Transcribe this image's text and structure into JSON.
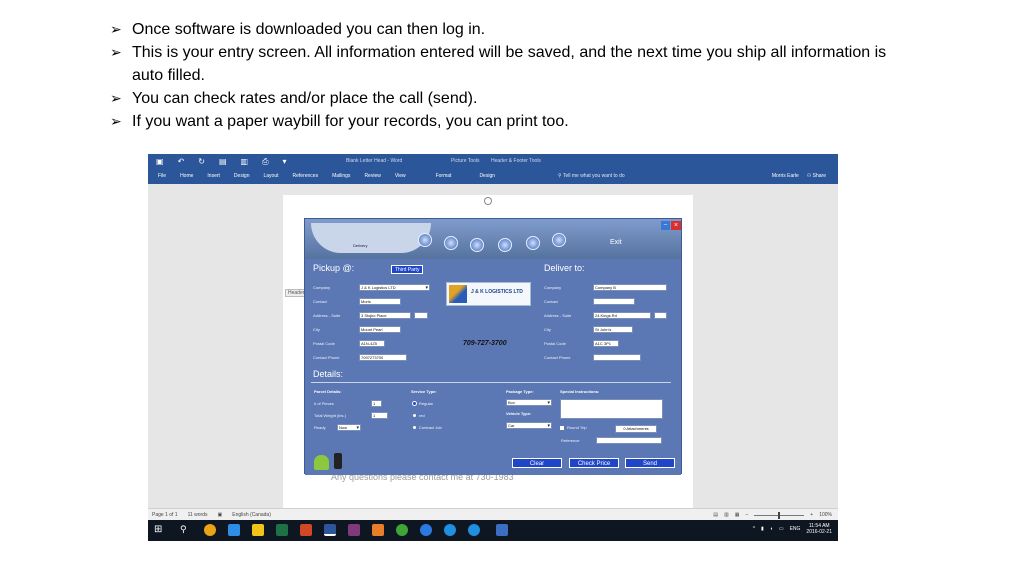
{
  "bullets": [
    "Once software is downloaded you can then log in.",
    "This is your entry screen. All information entered will be saved, and the next time you ship all information is auto filled.",
    "You can check rates and/or place the call (send).",
    "If you want a paper waybill for your records, you can print too."
  ],
  "bullet_marker": "➢",
  "word": {
    "title": "Blank Letter Head - Word",
    "contextual": [
      "Picture Tools",
      "Header & Footer Tools"
    ],
    "tabs": [
      "File",
      "Home",
      "Insert",
      "Design",
      "Layout",
      "References",
      "Mailings",
      "Review",
      "View",
      "Format",
      "Design"
    ],
    "tell_me": "Tell me what you want to do",
    "user": "Morris Earle",
    "share": "Share",
    "header_tag": "Header",
    "doc_text": "Any questions please contact me at 730-1983",
    "status": {
      "page": "Page 1 of 1",
      "words": "11 words",
      "language": "English (Canada)",
      "zoom": "100%"
    }
  },
  "app": {
    "delivery_tab": "Delivery",
    "exit_label": "Exit",
    "minimize_label": "–",
    "close_label": "×",
    "pickup_title": "Pickup @:",
    "third_party": "Third Party",
    "deliver_title": "Deliver to:",
    "logo_text": "J & K LOGISTICS LTD",
    "phone": "709-727-3700",
    "pickup": {
      "company_label": "Company",
      "company": "J & K Logistics LTD",
      "contact_label": "Contact",
      "contact": "Moris",
      "address_label": "Address - Suite",
      "address": "3 Stojko Place",
      "city_label": "City",
      "city": "Mount Pearl",
      "postal_label": "Postal Code",
      "postal": "A1N-4Z5",
      "phone_label": "Contact Phone",
      "phone": "7097273700"
    },
    "deliver": {
      "company_label": "Company",
      "company": "Company B",
      "contact_label": "Contact",
      "contact": "",
      "address_label": "Address - Suite",
      "address": "24 Kings Rd",
      "city_label": "City",
      "city": "St John's",
      "postal_label": "Postal Code",
      "postal": "A1C 3P1",
      "phone_label": "Contact Phone",
      "phone": ""
    },
    "details_title": "Details:",
    "parcel": {
      "title": "Parcel Details:",
      "pieces_label": "# of Pieces",
      "pieces": "1",
      "weight_label": "Total Weight (lbs.)",
      "weight": "1",
      "ready_label": "Ready",
      "ready": "Now"
    },
    "service": {
      "title": "Service Type:",
      "options": [
        "Regular",
        "red",
        "Contract Job"
      ],
      "selected": "Regular"
    },
    "package": {
      "title": "Package Type:",
      "value": "Box",
      "vehicle_title": "Vehicle Type:",
      "vehicle": "Car"
    },
    "special": {
      "title": "Special Instructions:",
      "round_trip": "Round Trip",
      "attachments": "0 Attachments",
      "reference_label": "Reference"
    },
    "buttons": {
      "clear": "Clear",
      "check_price": "Check Price",
      "send": "Send"
    }
  },
  "taskbar": {
    "lang": "ENG",
    "time": "11:54 AM",
    "date": "2016-02-21"
  }
}
